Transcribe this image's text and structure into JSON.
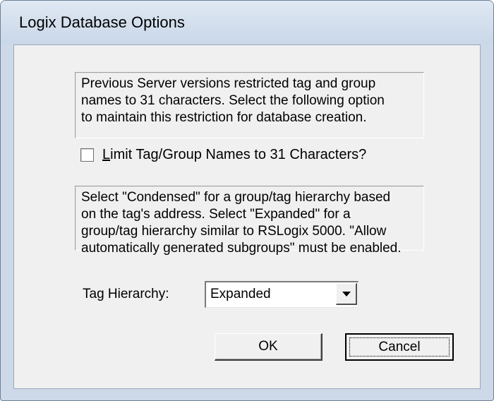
{
  "window": {
    "title": "Logix Database Options"
  },
  "info1": {
    "text": "Previous Server versions restricted tag and group\nnames to 31 characters.  Select the following option\nto maintain this restriction for database creation."
  },
  "limit_checkbox": {
    "label_first": "L",
    "label_rest": "imit Tag/Group Names to 31 Characters?",
    "checked": false
  },
  "info2": {
    "text": "Select \"Condensed\" for a group/tag hierarchy based\non the tag's address.  Select \"Expanded\" for a\ngroup/tag hierarchy similar to RSLogix 5000.  \"Allow\nautomatically generated subgroups\" must be enabled."
  },
  "tag_hierarchy": {
    "label": "Tag Hierarchy:",
    "selected": "Expanded"
  },
  "buttons": {
    "ok": "OK",
    "cancel": "Cancel"
  }
}
